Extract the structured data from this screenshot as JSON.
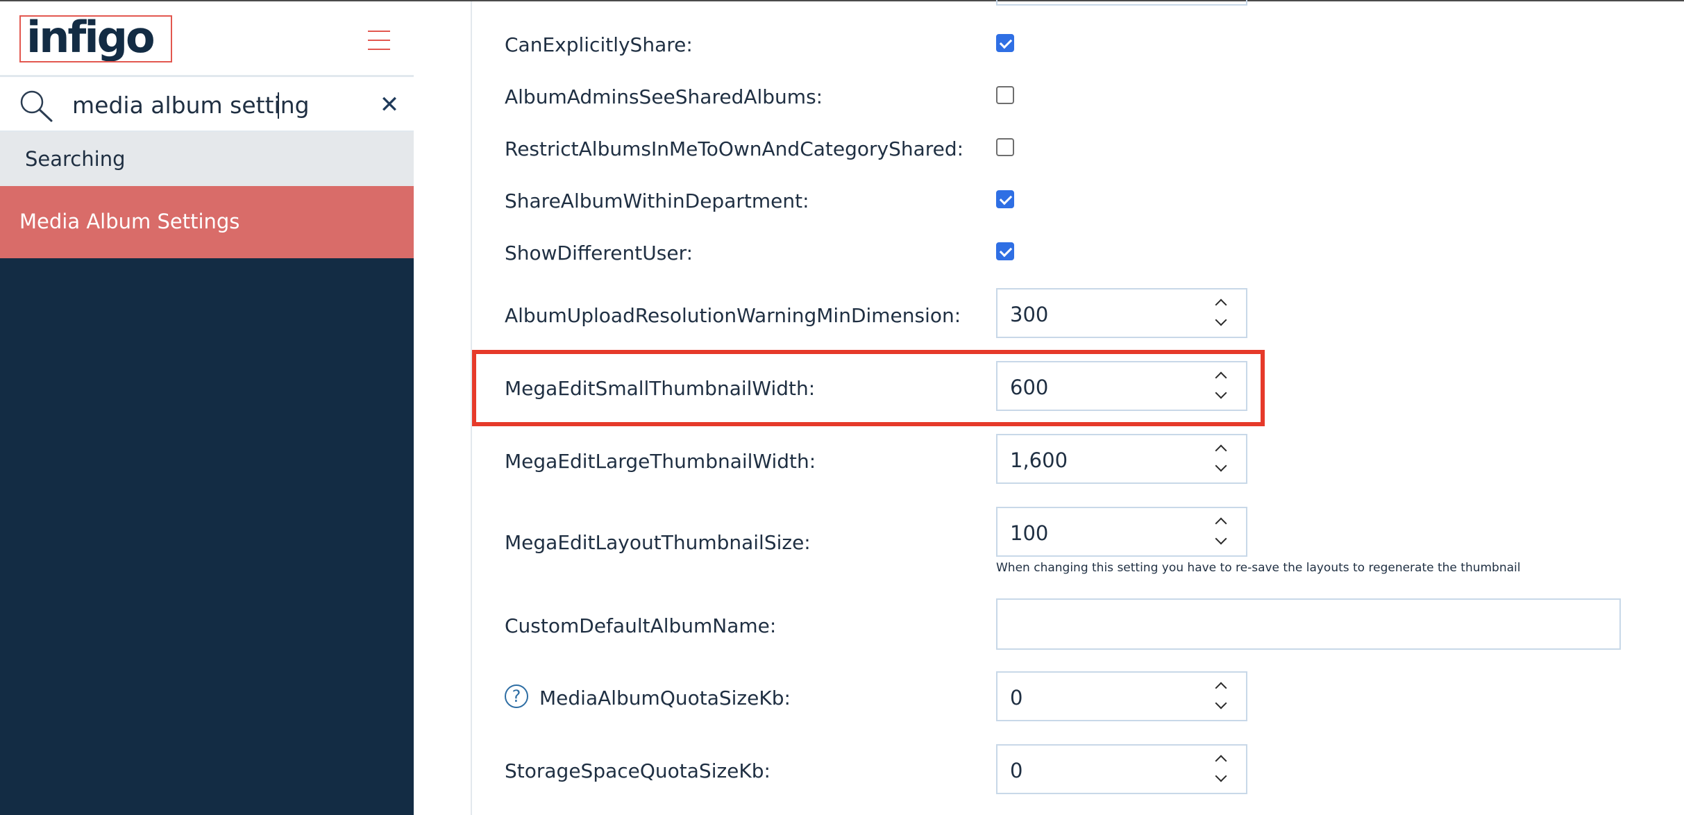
{
  "sidebar": {
    "logo_text": "infigo",
    "search": {
      "value": "media album setting",
      "placeholder": ""
    },
    "status_text": "Searching",
    "results": [
      {
        "label": "Media Album Settings"
      }
    ]
  },
  "settings": {
    "can_explicitly_share": {
      "label": "CanExplicitlyShare:",
      "checked": true
    },
    "album_admins_see_shared_albums": {
      "label": "AlbumAdminsSeeSharedAlbums:",
      "checked": false
    },
    "restrict_albums": {
      "label": "RestrictAlbumsInMeToOwnAndCategoryShared:",
      "checked": false
    },
    "share_album_within_department": {
      "label": "ShareAlbumWithinDepartment:",
      "checked": true
    },
    "show_different_user": {
      "label": "ShowDifferentUser:",
      "checked": true
    },
    "album_upload_resolution": {
      "label": "AlbumUploadResolutionWarningMinDimension:",
      "value": "300"
    },
    "mega_edit_small_thumb": {
      "label": "MegaEditSmallThumbnailWidth:",
      "value": "600"
    },
    "mega_edit_large_thumb": {
      "label": "MegaEditLargeThumbnailWidth:",
      "value": "1,600"
    },
    "mega_edit_layout_thumb": {
      "label": "MegaEditLayoutThumbnailSize:",
      "value": "100",
      "hint": "When changing this setting you have to re-save the layouts to regenerate the thumbnail"
    },
    "custom_default_album_name": {
      "label": "CustomDefaultAlbumName:",
      "value": ""
    },
    "media_album_quota": {
      "label": "MediaAlbumQuotaSizeKb:",
      "value": "0",
      "help_icon": "?"
    },
    "storage_space_quota": {
      "label": "StorageSpaceQuotaSizeKb:",
      "value": "0"
    }
  },
  "colors": {
    "sidebar_bg": "#132c44",
    "accent": "#e2574f",
    "result_bg": "#d96c69",
    "checkbox": "#2f6fe4",
    "highlight": "#e63a2a"
  }
}
